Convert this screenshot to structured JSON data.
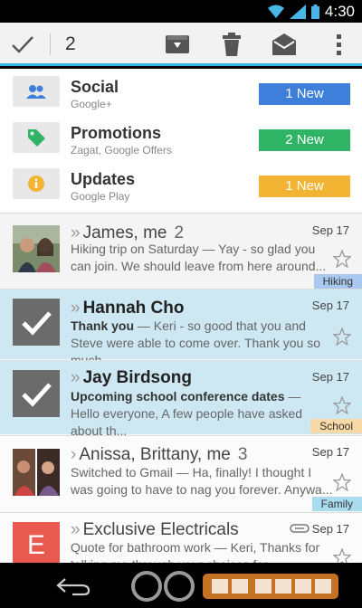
{
  "status": {
    "time": "4:30"
  },
  "action_bar": {
    "selected_count": "2"
  },
  "categories": [
    {
      "title": "Social",
      "subtitle": "Google+",
      "badge": "1 New",
      "color": "#3d7fdb"
    },
    {
      "title": "Promotions",
      "subtitle": "Zagat, Google Offers",
      "badge": "2 New",
      "color": "#2fb365"
    },
    {
      "title": "Updates",
      "subtitle": "Google Play",
      "badge": "1 New",
      "color": "#f2b432"
    }
  ],
  "emails": [
    {
      "sender": "James, me",
      "count": "2",
      "date": "Sep 17",
      "subject": "Hiking trip on Saturday",
      "preview": " — Yay - so glad you can join. We should leave from here around...",
      "label": "Hiking",
      "label_color": "#a8c8ef",
      "selected": false
    },
    {
      "sender": "Hannah Cho",
      "count": "",
      "date": "Sep 17",
      "subject": "Thank you",
      "preview": " — Keri - so good that you and Steve were able to come over. Thank you so much...",
      "label": "",
      "selected": true
    },
    {
      "sender": "Jay Birdsong",
      "count": "",
      "date": "Sep 17",
      "subject": "Upcoming school conference dates",
      "preview": " — Hello everyone, A few people have asked about th...",
      "label": "School",
      "label_color": "#f6d9a4",
      "selected": true
    },
    {
      "sender": "Anissa, Brittany, me",
      "count": "3",
      "date": "Sep 17",
      "subject": "Switched to Gmail",
      "preview": " — Ha, finally! I thought I was going to have to nag you forever. Anywa...",
      "label": "Family",
      "label_color": "#a9dcef",
      "selected": false
    },
    {
      "sender": "Exclusive Electricals",
      "count": "",
      "date": "Sep 17",
      "subject": "Quote for bathroom work",
      "preview": " — Keri, Thanks for talking me through your choices for bathroom...",
      "label": "",
      "initial": "E",
      "initial_color": "#e8594f",
      "selected": false
    }
  ]
}
